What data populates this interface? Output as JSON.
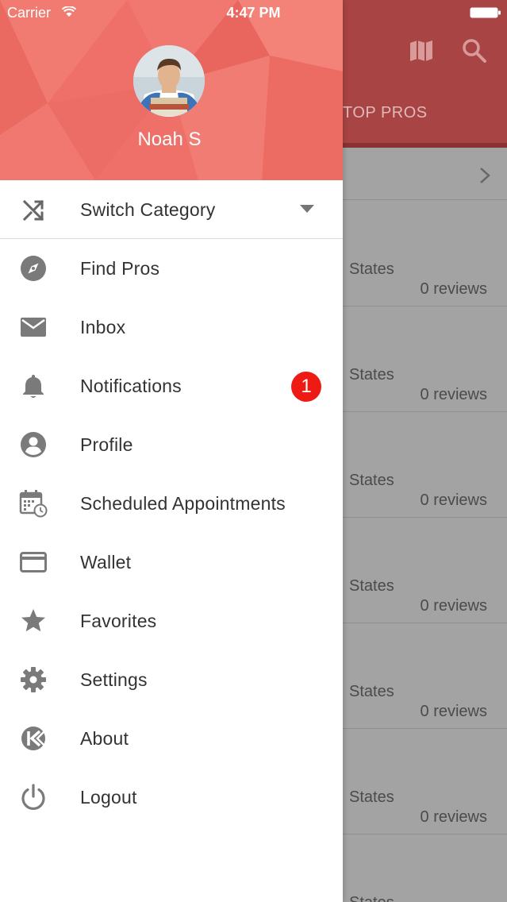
{
  "status_bar": {
    "carrier": "Carrier",
    "time": "4:47 PM"
  },
  "drawer": {
    "user_name": "Noah S",
    "switch_category": {
      "label": "Switch Category",
      "icon": "shuffle-icon"
    },
    "items": [
      {
        "id": "find-pros",
        "label": "Find Pros",
        "icon": "compass-icon"
      },
      {
        "id": "inbox",
        "label": "Inbox",
        "icon": "mail-icon"
      },
      {
        "id": "notifications",
        "label": "Notifications",
        "icon": "bell-icon",
        "badge": "1"
      },
      {
        "id": "profile",
        "label": "Profile",
        "icon": "account-circle-icon"
      },
      {
        "id": "scheduled-appointments",
        "label": "Scheduled Appointments",
        "icon": "calendar-clock-icon"
      },
      {
        "id": "wallet",
        "label": "Wallet",
        "icon": "credit-card-icon"
      },
      {
        "id": "favorites",
        "label": "Favorites",
        "icon": "star-icon"
      },
      {
        "id": "settings",
        "label": "Settings",
        "icon": "gear-icon"
      },
      {
        "id": "about",
        "label": "About",
        "icon": "app-logo-icon"
      },
      {
        "id": "logout",
        "label": "Logout",
        "icon": "power-icon"
      }
    ]
  },
  "background": {
    "tab_label": "TOP PROS",
    "cards": [
      {
        "location": "States",
        "reviews": "0 reviews"
      },
      {
        "location": "States",
        "reviews": "0 reviews"
      },
      {
        "location": "States",
        "reviews": "0 reviews"
      },
      {
        "location": "States",
        "reviews": "0 reviews"
      },
      {
        "location": "States",
        "reviews": "0 reviews"
      },
      {
        "location": "States",
        "reviews": "0 reviews"
      },
      {
        "location": "States",
        "reviews": ""
      }
    ]
  },
  "colors": {
    "header": "#ee7068",
    "badge": "#ee1b14",
    "bg_header": "#a84444",
    "overlay": "#a3a3a3"
  }
}
